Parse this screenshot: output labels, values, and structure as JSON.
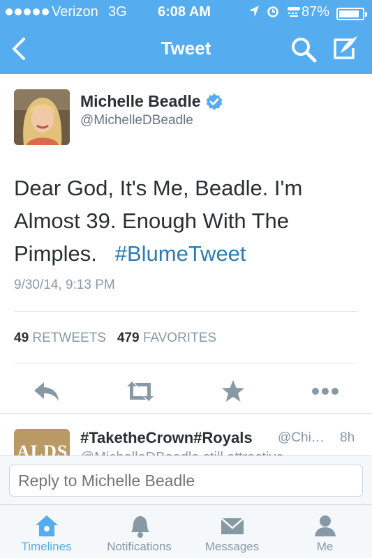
{
  "status_bar": {
    "carrier": "Verizon",
    "network": "3G",
    "time": "6:08 AM",
    "battery_percent": "87%",
    "battery_level": 0.87
  },
  "nav": {
    "title": "Tweet"
  },
  "tweet": {
    "author_name": "Michelle Beadle",
    "handle": "@MichelleDBeadle",
    "verified": true,
    "text_lines": [
      "Dear God, It's Me, Beadle.  I'm",
      "Almost 39. Enough With The",
      "Pimples."
    ],
    "hashtag": "#BlumeTweet",
    "timestamp": "9/30/14, 9:13 PM",
    "retweets_count": "49",
    "retweets_label": "RETWEETS",
    "favorites_count": "479",
    "favorites_label": "FAVORITES"
  },
  "actions": {
    "reply_icon": "reply-icon",
    "retweet_icon": "retweet-icon",
    "favorite_icon": "star-icon",
    "more_icon": "more-icon"
  },
  "reply_preview": {
    "name": "#TaketheCrown#Royals",
    "handle": "@Chi…",
    "time": "8h",
    "text": "@MichelleDBeadle still attractive",
    "avatar_text": "ALDS"
  },
  "reply_bar": {
    "placeholder": "Reply to Michelle Beadle"
  },
  "tabbar": {
    "tabs": [
      {
        "label": "Timelines",
        "icon": "home-icon",
        "active": true
      },
      {
        "label": "Notifications",
        "icon": "bell-icon",
        "active": false
      },
      {
        "label": "Messages",
        "icon": "envelope-icon",
        "active": false
      },
      {
        "label": "Me",
        "icon": "person-icon",
        "active": false
      }
    ]
  },
  "colors": {
    "header_blue": "#55acee",
    "hashtag_blue": "#2b7bb9",
    "icon_gray": "#8899a6"
  }
}
